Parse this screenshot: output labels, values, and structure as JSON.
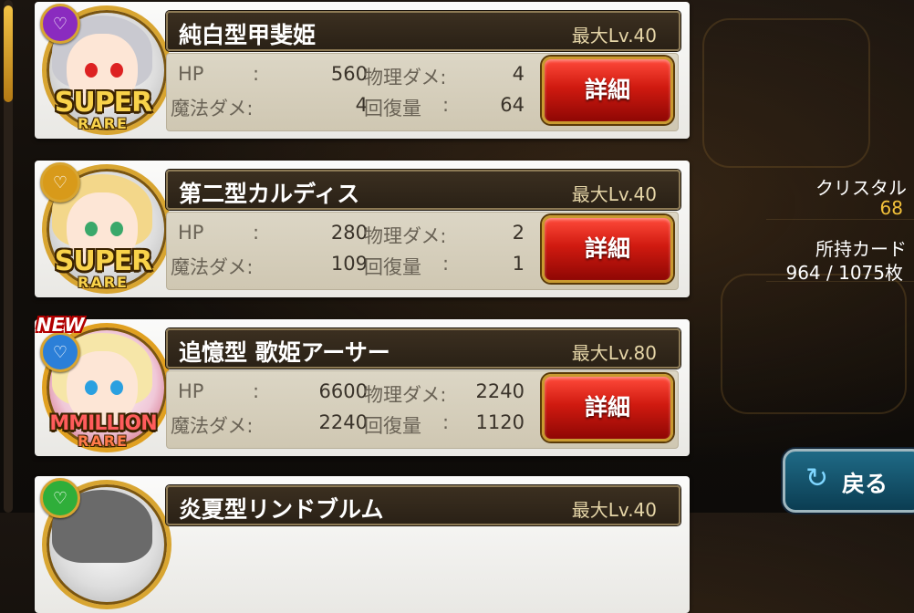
{
  "cards": [
    {
      "name": "純白型甲斐姫",
      "max_level": "最大Lv.40",
      "hp_label": "HP",
      "hp_value": "560",
      "phys_label": "物理ダメ:",
      "phys_value": "4",
      "magic_label": "魔法ダメ:",
      "magic_value": "4",
      "heal_label": "回復量",
      "heal_value": "64",
      "colon": ":",
      "detail_label": "詳細",
      "rarity_big": "SUPER",
      "rarity_small": "RARE",
      "new_tag": "",
      "attribute_icon": "heart-icon",
      "attribute_color": "#8a2bbf",
      "hair_color": "#c9c9d0"
    },
    {
      "name": "第二型カルディス",
      "max_level": "最大Lv.40",
      "hp_label": "HP",
      "hp_value": "280",
      "phys_label": "物理ダメ:",
      "phys_value": "2",
      "magic_label": "魔法ダメ:",
      "magic_value": "109",
      "heal_label": "回復量",
      "heal_value": "1",
      "colon": ":",
      "detail_label": "詳細",
      "rarity_big": "SUPER",
      "rarity_small": "RARE",
      "new_tag": "",
      "attribute_icon": "heart-icon",
      "attribute_color": "#d89a1a",
      "hair_color": "#f3d78a"
    },
    {
      "name": "追憶型 歌姫アーサー",
      "max_level": "最大Lv.80",
      "hp_label": "HP",
      "hp_value": "6600",
      "phys_label": "物理ダメ:",
      "phys_value": "2240",
      "magic_label": "魔法ダメ:",
      "magic_value": "2240",
      "heal_label": "回復量",
      "heal_value": "1120",
      "colon": ":",
      "detail_label": "詳細",
      "rarity_big": "MMILLION",
      "rarity_small": "RARE",
      "new_tag": "NEW",
      "attribute_icon": "heart-icon",
      "attribute_color": "#2b7fd8",
      "hair_color": "#f6e6a8"
    },
    {
      "name": "炎夏型リンドブルム",
      "max_level": "最大Lv.40",
      "attribute_icon": "heart-icon",
      "attribute_color": "#2fae3a",
      "hair_color": "#6a6a6a"
    }
  ],
  "sidebar": {
    "crystal_label": "クリスタル",
    "crystal_value": "68",
    "cards_label": "所持カード",
    "cards_value": "964 / 1075枚"
  },
  "back_button": {
    "label": "戻る",
    "icon": "return-arrow-icon"
  },
  "colors": {
    "gold": "#d8a531",
    "crystal_value": "#f3c13a",
    "detail_button": "#d01a10"
  }
}
